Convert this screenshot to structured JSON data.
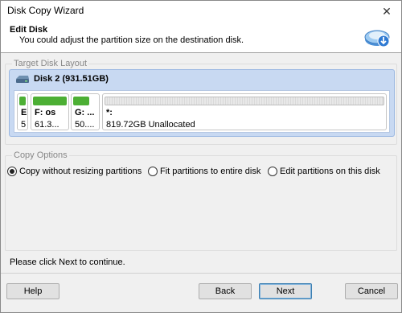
{
  "window": {
    "title": "Disk Copy Wizard",
    "close_glyph": "✕"
  },
  "header": {
    "title": "Edit Disk",
    "subtitle": "You could adjust the partition size on the destination disk.",
    "icon": "disk-copy-icon"
  },
  "target_layout": {
    "legend": "Target Disk Layout",
    "disk_label": "Disk 2 (931.51GB)",
    "partitions": [
      {
        "label": "E",
        "size": "5",
        "type": "used"
      },
      {
        "label": "F: os",
        "size": "61.3...",
        "type": "used"
      },
      {
        "label": "G: ...",
        "size": "50....",
        "type": "used"
      },
      {
        "label": "*:",
        "size": "819.72GB Unallocated",
        "type": "unallocated"
      }
    ]
  },
  "copy_options": {
    "legend": "Copy Options",
    "options": [
      {
        "label": "Copy without resizing partitions",
        "selected": true
      },
      {
        "label": "Fit partitions to entire disk",
        "selected": false
      },
      {
        "label": "Edit partitions on this disk",
        "selected": false
      }
    ]
  },
  "hint": "Please click Next to continue.",
  "buttons": {
    "help": "Help",
    "back": "Back",
    "next": "Next",
    "cancel": "Cancel"
  }
}
